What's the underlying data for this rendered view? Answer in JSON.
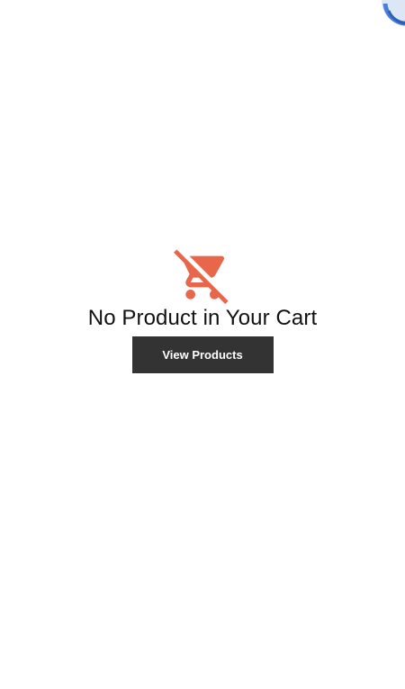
{
  "empty_cart": {
    "icon": "remove-shopping-cart-icon",
    "title": "No Product in Your Cart",
    "button_label": "View Products"
  },
  "colors": {
    "icon": "#e8664a",
    "button_bg": "#333333",
    "button_text": "#ffffff",
    "corner_widget": "#4a7fd6"
  }
}
